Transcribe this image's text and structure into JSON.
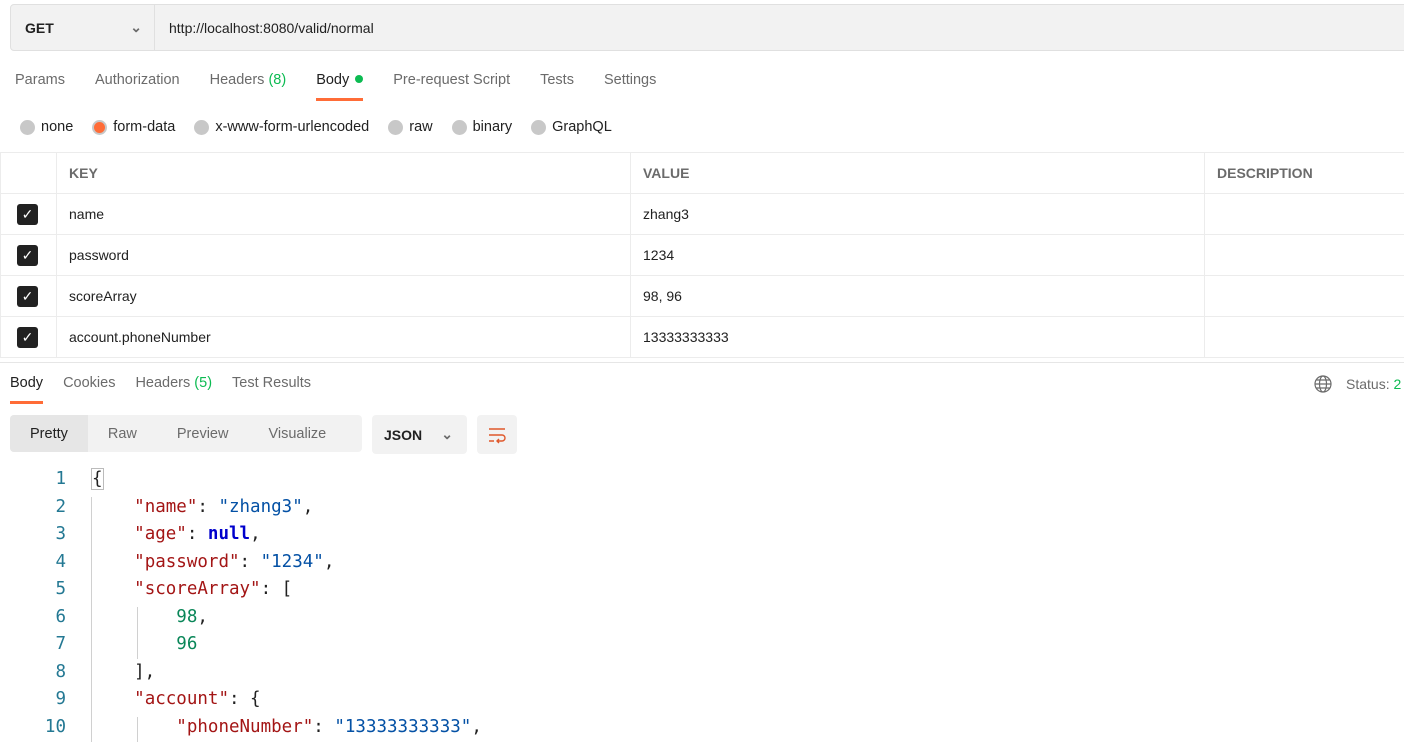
{
  "request": {
    "method": "GET",
    "url": "http://localhost:8080/valid/normal"
  },
  "tabs": [
    {
      "label": "Params"
    },
    {
      "label": "Authorization"
    },
    {
      "label": "Headers",
      "count": "(8)"
    },
    {
      "label": "Body"
    },
    {
      "label": "Pre-request Script"
    },
    {
      "label": "Tests"
    },
    {
      "label": "Settings"
    }
  ],
  "body_types": [
    "none",
    "form-data",
    "x-www-form-urlencoded",
    "raw",
    "binary",
    "GraphQL"
  ],
  "selected_body_type": "form-data",
  "table": {
    "headers": [
      "KEY",
      "VALUE",
      "DESCRIPTION"
    ],
    "rows": [
      {
        "key": "name",
        "value": "zhang3",
        "checked": true
      },
      {
        "key": "password",
        "value": "1234",
        "checked": true
      },
      {
        "key": "scoreArray",
        "value": "98, 96",
        "checked": true
      },
      {
        "key": "account.phoneNumber",
        "value": "13333333333",
        "checked": true
      }
    ]
  },
  "response": {
    "tabs": [
      {
        "label": "Body"
      },
      {
        "label": "Cookies"
      },
      {
        "label": "Headers",
        "count": "(5)"
      },
      {
        "label": "Test Results"
      }
    ],
    "status_label": "Status:",
    "status_value": "2",
    "views": [
      "Pretty",
      "Raw",
      "Preview",
      "Visualize"
    ],
    "format": "JSON"
  },
  "code_lines": [
    "1",
    "2",
    "3",
    "4",
    "5",
    "6",
    "7",
    "8",
    "9",
    "10"
  ],
  "json": {
    "name_key": "\"name\"",
    "name_val": "\"zhang3\"",
    "age_key": "\"age\"",
    "age_val": "null",
    "password_key": "\"password\"",
    "password_val": "\"1234\"",
    "score_key": "\"scoreArray\"",
    "score_1": "98",
    "score_2": "96",
    "account_key": "\"account\"",
    "phone_key": "\"phoneNumber\"",
    "phone_val": "\"13333333333\""
  },
  "colors": {
    "accent": "#ff6c37",
    "green": "#0cbb52"
  }
}
